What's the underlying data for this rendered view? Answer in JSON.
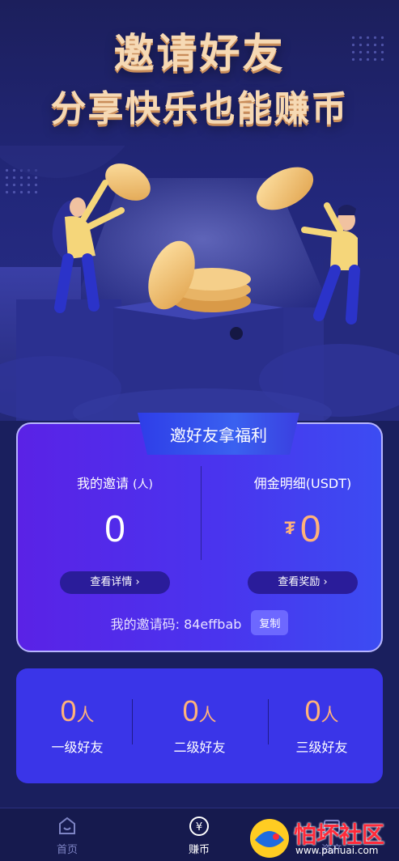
{
  "hero": {
    "title_line1": "邀请好友",
    "title_line2": "分享快乐也能赚币"
  },
  "card": {
    "tab_title": "邀好友拿福利",
    "my_invites": {
      "label": "我的邀请",
      "unit": "(人)",
      "value": "0",
      "button": "查看详情 ›"
    },
    "commission": {
      "label": "佣金明细(USDT)",
      "currency_symbol": "₮",
      "value": "0",
      "button": "查看奖励 ›"
    },
    "invite_code_label": "我的邀请码:",
    "invite_code": "84effbab",
    "copy_button": "复制"
  },
  "friends": [
    {
      "count": "0",
      "unit": "人",
      "label": "一级好友"
    },
    {
      "count": "0",
      "unit": "人",
      "label": "二级好友"
    },
    {
      "count": "0",
      "unit": "人",
      "label": "三级好友"
    }
  ],
  "tabbar": {
    "items": [
      {
        "label": "首页",
        "icon": "home-icon",
        "active": false
      },
      {
        "label": "赚币",
        "icon": "yen-coin-icon",
        "active": true
      },
      {
        "label": "资产",
        "icon": "wallet-icon",
        "active": false
      }
    ]
  },
  "watermark": {
    "text": "怕坏社区",
    "url": "www.pahuai.com"
  },
  "colors": {
    "accent_orange": "#ffb27a",
    "card_purple": "#5a22e6",
    "friends_blue": "#3a35e8"
  }
}
